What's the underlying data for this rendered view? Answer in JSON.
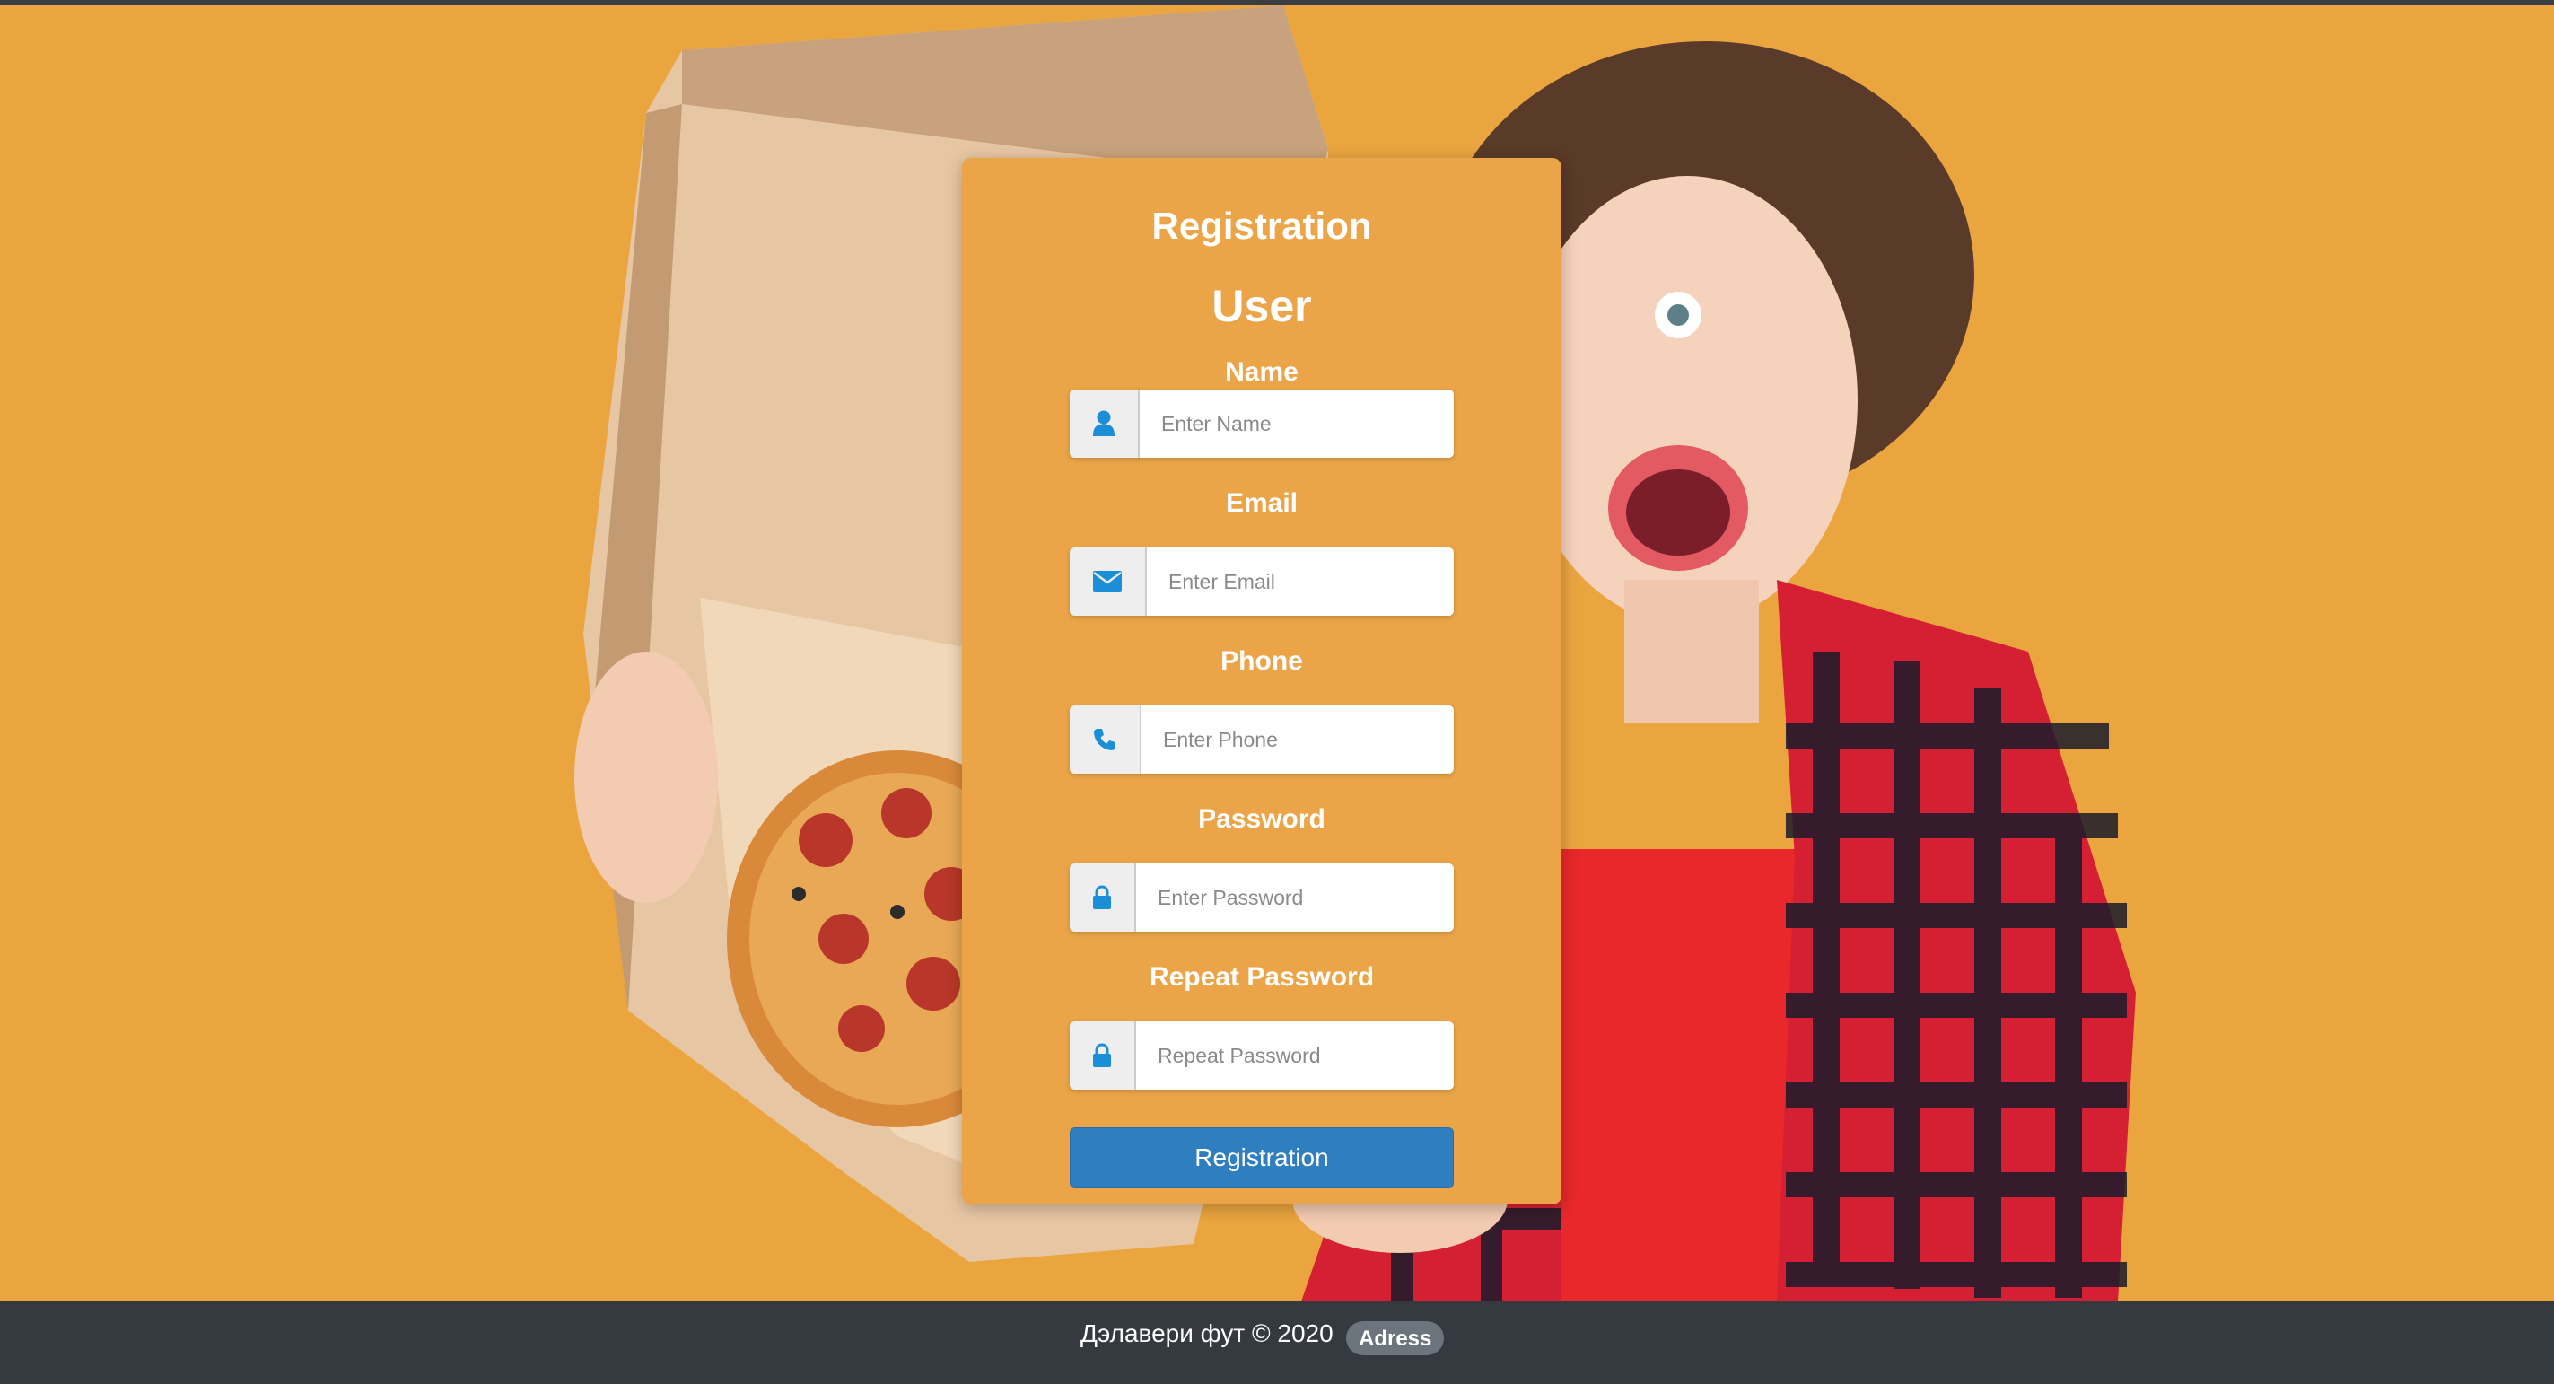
{
  "form": {
    "title": "Registration",
    "subtitle": "User",
    "fields": [
      {
        "label": "Name",
        "placeholder": "Enter Name",
        "icon": "user-icon"
      },
      {
        "label": "Email",
        "placeholder": "Enter Email",
        "icon": "envelope-icon"
      },
      {
        "label": "Phone",
        "placeholder": "Enter Phone",
        "icon": "phone-icon"
      },
      {
        "label": "Password",
        "placeholder": "Enter Password",
        "icon": "lock-icon"
      },
      {
        "label": "Repeat Password",
        "placeholder": "Repeat Password",
        "icon": "lock-icon"
      }
    ],
    "submit_label": "Registration"
  },
  "footer": {
    "copyright": "Дэлавери фут © 2020",
    "address_badge": "Adress"
  },
  "colors": {
    "background": "#eaa53f",
    "card": "#eba548",
    "button": "#2f7ec0",
    "icon": "#1a8ed6",
    "footer": "#343a40"
  }
}
